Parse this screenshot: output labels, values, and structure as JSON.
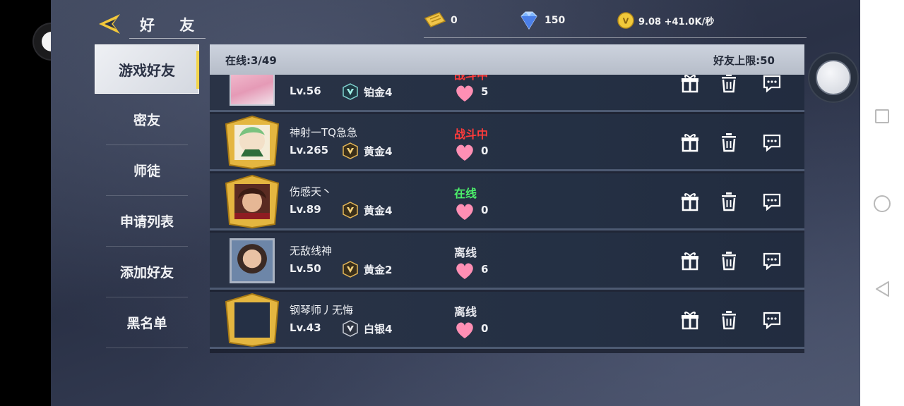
{
  "header": {
    "title": "好 友",
    "resources": [
      {
        "icon": "gold-ticket-icon",
        "value": "0"
      },
      {
        "icon": "diamond-icon",
        "value": "150"
      },
      {
        "icon": "coin-icon",
        "value": "9.08 +41.0K/秒"
      }
    ]
  },
  "menu": {
    "items": [
      {
        "label": "游戏好友",
        "active": true
      },
      {
        "label": "密友"
      },
      {
        "label": "师徒"
      },
      {
        "label": "申请列表"
      },
      {
        "label": "添加好友"
      },
      {
        "label": "黑名单"
      }
    ]
  },
  "panel": {
    "online_label": "在线:3/49",
    "limit_label": "好友上限:50"
  },
  "friends": [
    {
      "name": "",
      "level": "Lv.56",
      "rank": "铂金4",
      "status": "战斗中",
      "status_color": "#ff3b3b",
      "hearts": "5"
    },
    {
      "name": "神射一TQ急急",
      "level": "Lv.265",
      "rank": "黄金4",
      "status": "战斗中",
      "status_color": "#ff3b3b",
      "hearts": "0"
    },
    {
      "name": "伤感天丶",
      "level": "Lv.89",
      "rank": "黄金4",
      "status": "在线",
      "status_color": "#4cf06a",
      "hearts": "0"
    },
    {
      "name": "无敌线神",
      "level": "Lv.50",
      "rank": "黄金2",
      "status": "离线",
      "status_color": "#e8e9ee",
      "hearts": "6"
    },
    {
      "name": "钢琴师丿无悔",
      "level": "Lv.43",
      "rank": "白银4",
      "status": "离线",
      "status_color": "#e8e9ee",
      "hearts": "0"
    }
  ]
}
